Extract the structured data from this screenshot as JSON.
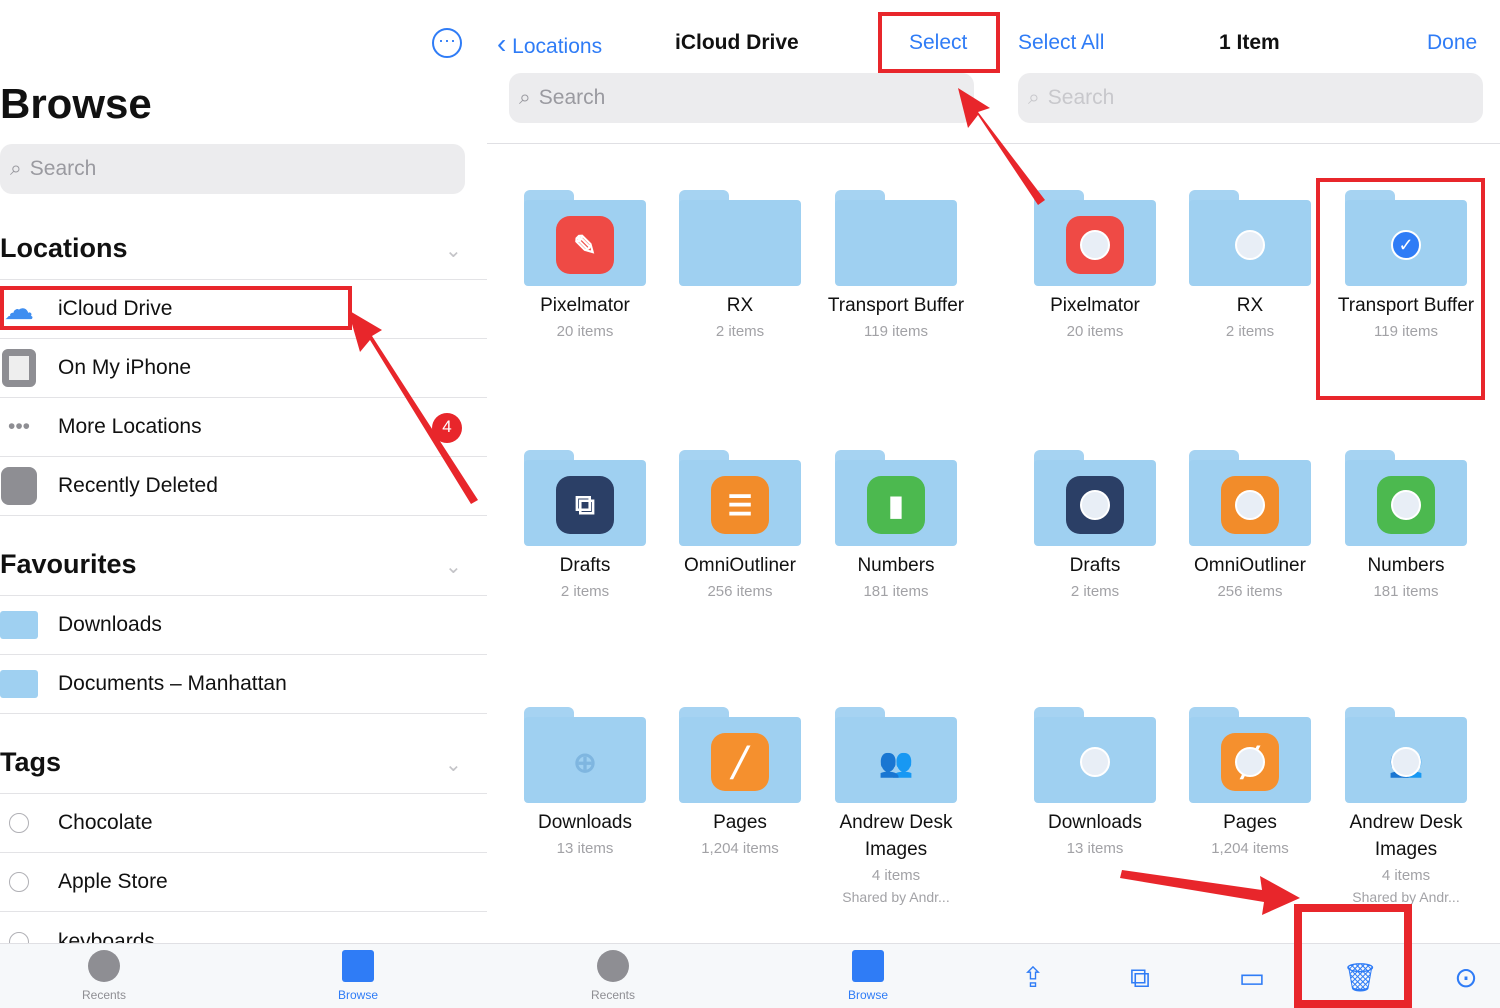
{
  "sidebar": {
    "more": "⋯",
    "title": "Browse",
    "search_placeholder": "Search",
    "locations_header": "Locations",
    "favourites_header": "Favourites",
    "tags_header": "Tags",
    "locations": [
      {
        "label": "iCloud Drive",
        "icon": "cloud-icon"
      },
      {
        "label": "On My iPhone",
        "icon": "iphone-icon"
      },
      {
        "label": "More Locations",
        "icon": "ellipsis-icon"
      },
      {
        "label": "Recently Deleted",
        "icon": "trash-icon"
      }
    ],
    "favourites": [
      {
        "label": "Downloads"
      },
      {
        "label": "Documents – Manhattan"
      }
    ],
    "tags": [
      {
        "label": "Chocolate"
      },
      {
        "label": "Apple Store"
      },
      {
        "label": "keyboards"
      }
    ]
  },
  "left_pane": {
    "back": "Locations",
    "title": "iCloud Drive",
    "select": "Select",
    "search_placeholder": "Search"
  },
  "right_pane": {
    "select_all": "Select All",
    "count": "1 Item",
    "done": "Done",
    "search_placeholder": "Search"
  },
  "folders": [
    {
      "name": "Pixelmator",
      "count": "20 items",
      "app": "#ef4a45",
      "glyph": "✎"
    },
    {
      "name": "RX",
      "count": "2 items",
      "app": null,
      "glyph": ""
    },
    {
      "name": "Transport Buffer",
      "count": "119 items",
      "app": null,
      "glyph": ""
    },
    {
      "name": "Drafts",
      "count": "2 items",
      "app": "#2b3f66",
      "glyph": "⧉"
    },
    {
      "name": "OmniOutliner",
      "count": "256 items",
      "app": "#f28c2a",
      "glyph": "☰"
    },
    {
      "name": "Numbers",
      "count": "181 items",
      "app": "#4cb94f",
      "glyph": "▮"
    },
    {
      "name": "Downloads",
      "count": "13 items",
      "app": null,
      "glyph": "⊕"
    },
    {
      "name": "Pages",
      "count": "1,204 items",
      "app": "#f5902e",
      "glyph": "╱"
    },
    {
      "name": "Andrew Desk Images",
      "count": "4 items",
      "shared": "Shared by Andr...",
      "app": null,
      "glyph": "👥"
    }
  ],
  "selected_folder": "Transport Buffer",
  "annotation": {
    "step": "4",
    "color": "#e8262b"
  },
  "tabbar": {
    "recents": "Recents",
    "browse": "Browse"
  },
  "toolbar": [
    "share-icon",
    "duplicate-icon",
    "move-folder-icon",
    "trash-icon",
    "more-icon"
  ],
  "colors": {
    "accent": "#2f7cf6",
    "folder": "#9fd0f1"
  }
}
